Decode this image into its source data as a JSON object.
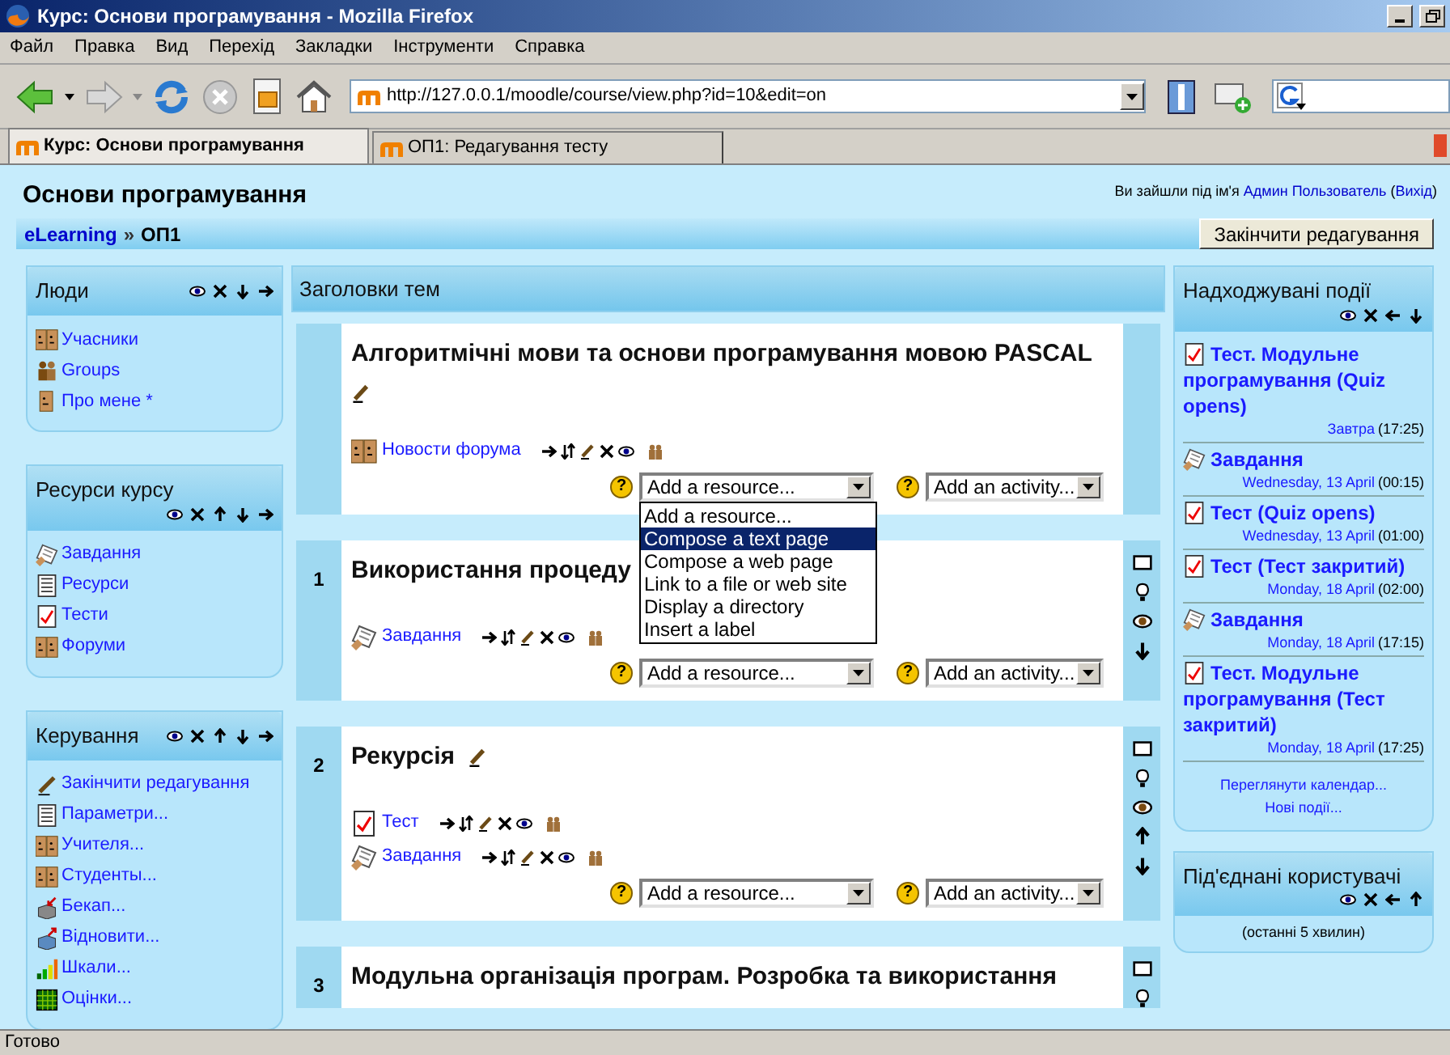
{
  "window": {
    "title": "Курс: Основи програмування - Mozilla Firefox"
  },
  "menu": [
    "Файл",
    "Правка",
    "Вид",
    "Перехід",
    "Закладки",
    "Інструменти",
    "Справка"
  ],
  "address": {
    "value": "http://127.0.0.1/moodle/course/view.php?id=10&edit=on"
  },
  "tabs": [
    {
      "label": "Курс: Основи програмування",
      "selected": true
    },
    {
      "label": "ОП1: Редагування тесту",
      "selected": false
    }
  ],
  "page": {
    "title": "Основи програмування",
    "login": {
      "text": "Ви зайшли під ім'я",
      "user": "Админ Пользователь",
      "brackets": [
        "(",
        ")"
      ],
      "logout": "Вихід"
    },
    "breadcrumb": {
      "items": [
        "eLearning",
        "ОП1"
      ],
      "separator": "»"
    },
    "edit_button": "Закінчити редагування",
    "help_mark": "?",
    "left_blocks": [
      {
        "title": "Люди",
        "controls": [
          {
            "kind": "hide"
          },
          {
            "kind": "delete"
          },
          {
            "kind": "down"
          },
          {
            "kind": "right"
          }
        ],
        "items": [
          {
            "kind": "people",
            "label": "Учасники"
          },
          {
            "kind": "groups",
            "label": "Groups"
          },
          {
            "kind": "person",
            "label": "Про мене *"
          }
        ]
      },
      {
        "title": "Ресурси курсу",
        "controls": [
          {
            "kind": "hide"
          },
          {
            "kind": "delete"
          },
          {
            "kind": "up"
          },
          {
            "kind": "down"
          },
          {
            "kind": "right"
          }
        ],
        "items": [
          {
            "kind": "assignment",
            "label": "Завдання"
          },
          {
            "kind": "resource",
            "label": "Ресурси"
          },
          {
            "kind": "quiz",
            "label": "Тести"
          },
          {
            "kind": "people",
            "label": "Форуми"
          }
        ]
      },
      {
        "title": "Керування",
        "controls": [
          {
            "kind": "hide"
          },
          {
            "kind": "delete"
          },
          {
            "kind": "up"
          },
          {
            "kind": "down"
          },
          {
            "kind": "right"
          }
        ],
        "items": [
          {
            "kind": "edit",
            "label": "Закінчити редагування"
          },
          {
            "kind": "resource",
            "label": "Параметри..."
          },
          {
            "kind": "people",
            "label": "Учителя..."
          },
          {
            "kind": "people",
            "label": "Студенты..."
          },
          {
            "kind": "backup",
            "label": "Бекап..."
          },
          {
            "kind": "restore",
            "label": "Відновити..."
          },
          {
            "kind": "scales",
            "label": "Шкали..."
          },
          {
            "kind": "grades",
            "label": "Оцінки..."
          }
        ]
      }
    ],
    "topics_heading": "Заголовки тем",
    "sections": [
      {
        "kind": "edit_below",
        "title": "Алгоритмічні мови та основи програмування мовою PASCAL",
        "activities": [
          {
            "kind": "people",
            "label": "Новости форума"
          }
        ],
        "add_resource": "Add a resource...",
        "add_activity": "Add an activity...",
        "resource_menu": {
          "options": [
            {
              "label": "Add a resource...",
              "selected": false
            },
            {
              "label": "Compose a text page",
              "selected": true
            },
            {
              "label": "Compose a web page",
              "selected": false
            },
            {
              "label": "Link to a file or web site",
              "selected": false
            },
            {
              "label": "Display a directory",
              "selected": false
            },
            {
              "label": "Insert a label",
              "selected": false
            }
          ]
        }
      },
      {
        "kind": "plain",
        "number": "1",
        "title": "Використання процеду",
        "activities": [
          {
            "kind": "assignment",
            "label": "Завдання"
          }
        ],
        "add_resource": "Add a resource...",
        "add_activity": "Add an activity...",
        "side_controls": [
          {
            "kind": "square"
          },
          {
            "kind": "bulb"
          },
          {
            "kind": "eye"
          },
          {
            "kind": "down"
          }
        ]
      },
      {
        "kind": "edit_inline",
        "number": "2",
        "title": "Рекурсія",
        "activities": [
          {
            "kind": "quiz",
            "label": "Тест"
          },
          {
            "kind": "assignment",
            "label": "Завдання"
          }
        ],
        "add_resource": "Add a resource...",
        "add_activity": "Add an activity...",
        "side_controls": [
          {
            "kind": "square"
          },
          {
            "kind": "bulb"
          },
          {
            "kind": "eye"
          },
          {
            "kind": "up"
          },
          {
            "kind": "down"
          }
        ]
      },
      {
        "kind": "plain",
        "number": "3",
        "title": "Модульна організація програм. Розробка та використання",
        "side_controls": [
          {
            "kind": "square"
          },
          {
            "kind": "bulb"
          }
        ]
      }
    ],
    "right_blocks": [
      {
        "title": "Надходжувані події",
        "controls": [
          {
            "kind": "hide"
          },
          {
            "kind": "delete"
          },
          {
            "kind": "left"
          },
          {
            "kind": "down"
          }
        ],
        "events": [
          {
            "kind": "quiz",
            "title": "Тест. Модульне програмування (Quiz opens)",
            "date": "Завтра",
            "time": "(17:25)"
          },
          {
            "kind": "assignment",
            "title": "Завдання",
            "date": "Wednesday, 13 April",
            "time": "(00:15)"
          },
          {
            "kind": "quiz",
            "title": "Тест (Quiz opens)",
            "date": "Wednesday, 13 April",
            "time": "(01:00)"
          },
          {
            "kind": "quiz",
            "title": "Тест (Тест закритий)",
            "date": "Monday, 18 April",
            "time": "(02:00)"
          },
          {
            "kind": "assignment",
            "title": "Завдання",
            "date": "Monday, 18 April",
            "time": "(17:15)"
          },
          {
            "kind": "quiz",
            "title": "Тест. Модульне програмування (Тест закритий)",
            "date": "Monday, 18 April",
            "time": "(17:25)"
          }
        ],
        "links": [
          "Переглянути календар...",
          "Нові події..."
        ]
      },
      {
        "title": "Під'єднані користувачі",
        "controls": [
          {
            "kind": "hide"
          },
          {
            "kind": "delete"
          },
          {
            "kind": "left"
          },
          {
            "kind": "up"
          }
        ],
        "note": "(останні 5 хвилин)"
      }
    ]
  },
  "status_bar": "Готово"
}
